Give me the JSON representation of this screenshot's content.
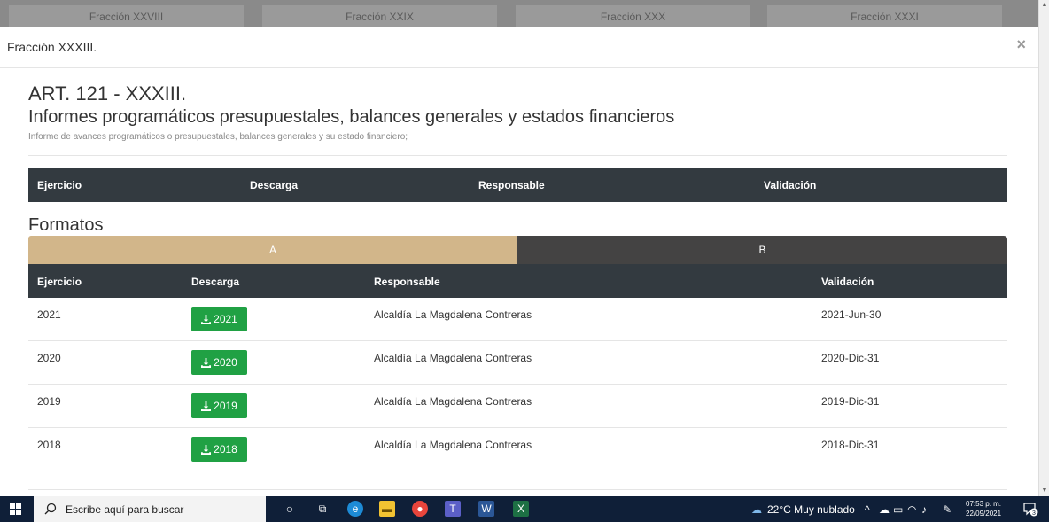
{
  "background": {
    "tabs": [
      "Fracción XXVIII",
      "Fracción XXIX",
      "Fracción XXX",
      "Fracción XXXI"
    ]
  },
  "modal": {
    "title": "Fracción XXXIII.",
    "close_label": "×",
    "art_title": "ART. 121 - XXXIII.",
    "art_subtitle": "Informes programáticos presupuestales, balances generales y estados financieros",
    "art_description": "Informe de avances programáticos o presupuestales, balances generales y su estado financiero;",
    "header_columns": [
      "Ejercicio",
      "Descarga",
      "Responsable",
      "Validación"
    ],
    "formatos_title": "Formatos",
    "tabs": [
      {
        "label": "A",
        "active": true,
        "color": "#d2b68a"
      },
      {
        "label": "B",
        "active": false,
        "color": "#444343"
      }
    ],
    "table_columns": [
      "Ejercicio",
      "Descarga",
      "Responsable",
      "Validación"
    ],
    "rows": [
      {
        "ejercicio": "2021",
        "descarga": "2021",
        "responsable": "Alcaldía La Magdalena Contreras",
        "validacion": "2021-Jun-30"
      },
      {
        "ejercicio": "2020",
        "descarga": "2020",
        "responsable": "Alcaldía La Magdalena Contreras",
        "validacion": "2020-Dic-31"
      },
      {
        "ejercicio": "2019",
        "descarga": "2019",
        "responsable": "Alcaldía La Magdalena Contreras",
        "validacion": "2019-Dic-31"
      },
      {
        "ejercicio": "2018",
        "descarga": "2018",
        "responsable": "Alcaldía La Magdalena Contreras",
        "validacion": "2018-Dic-31"
      }
    ],
    "download_button_color": "#20a144"
  },
  "taskbar": {
    "search_placeholder": "Escribe aquí para buscar",
    "weather": "22°C  Muy nublado",
    "time": "07:53 p. m.",
    "date": "22/09/2021",
    "notification_count": "3",
    "icons": [
      "windows-start-icon",
      "cortana-icon",
      "task-view-icon",
      "edge-icon",
      "file-explorer-icon",
      "chrome-icon",
      "teams-icon",
      "word-icon",
      "excel-icon"
    ]
  }
}
